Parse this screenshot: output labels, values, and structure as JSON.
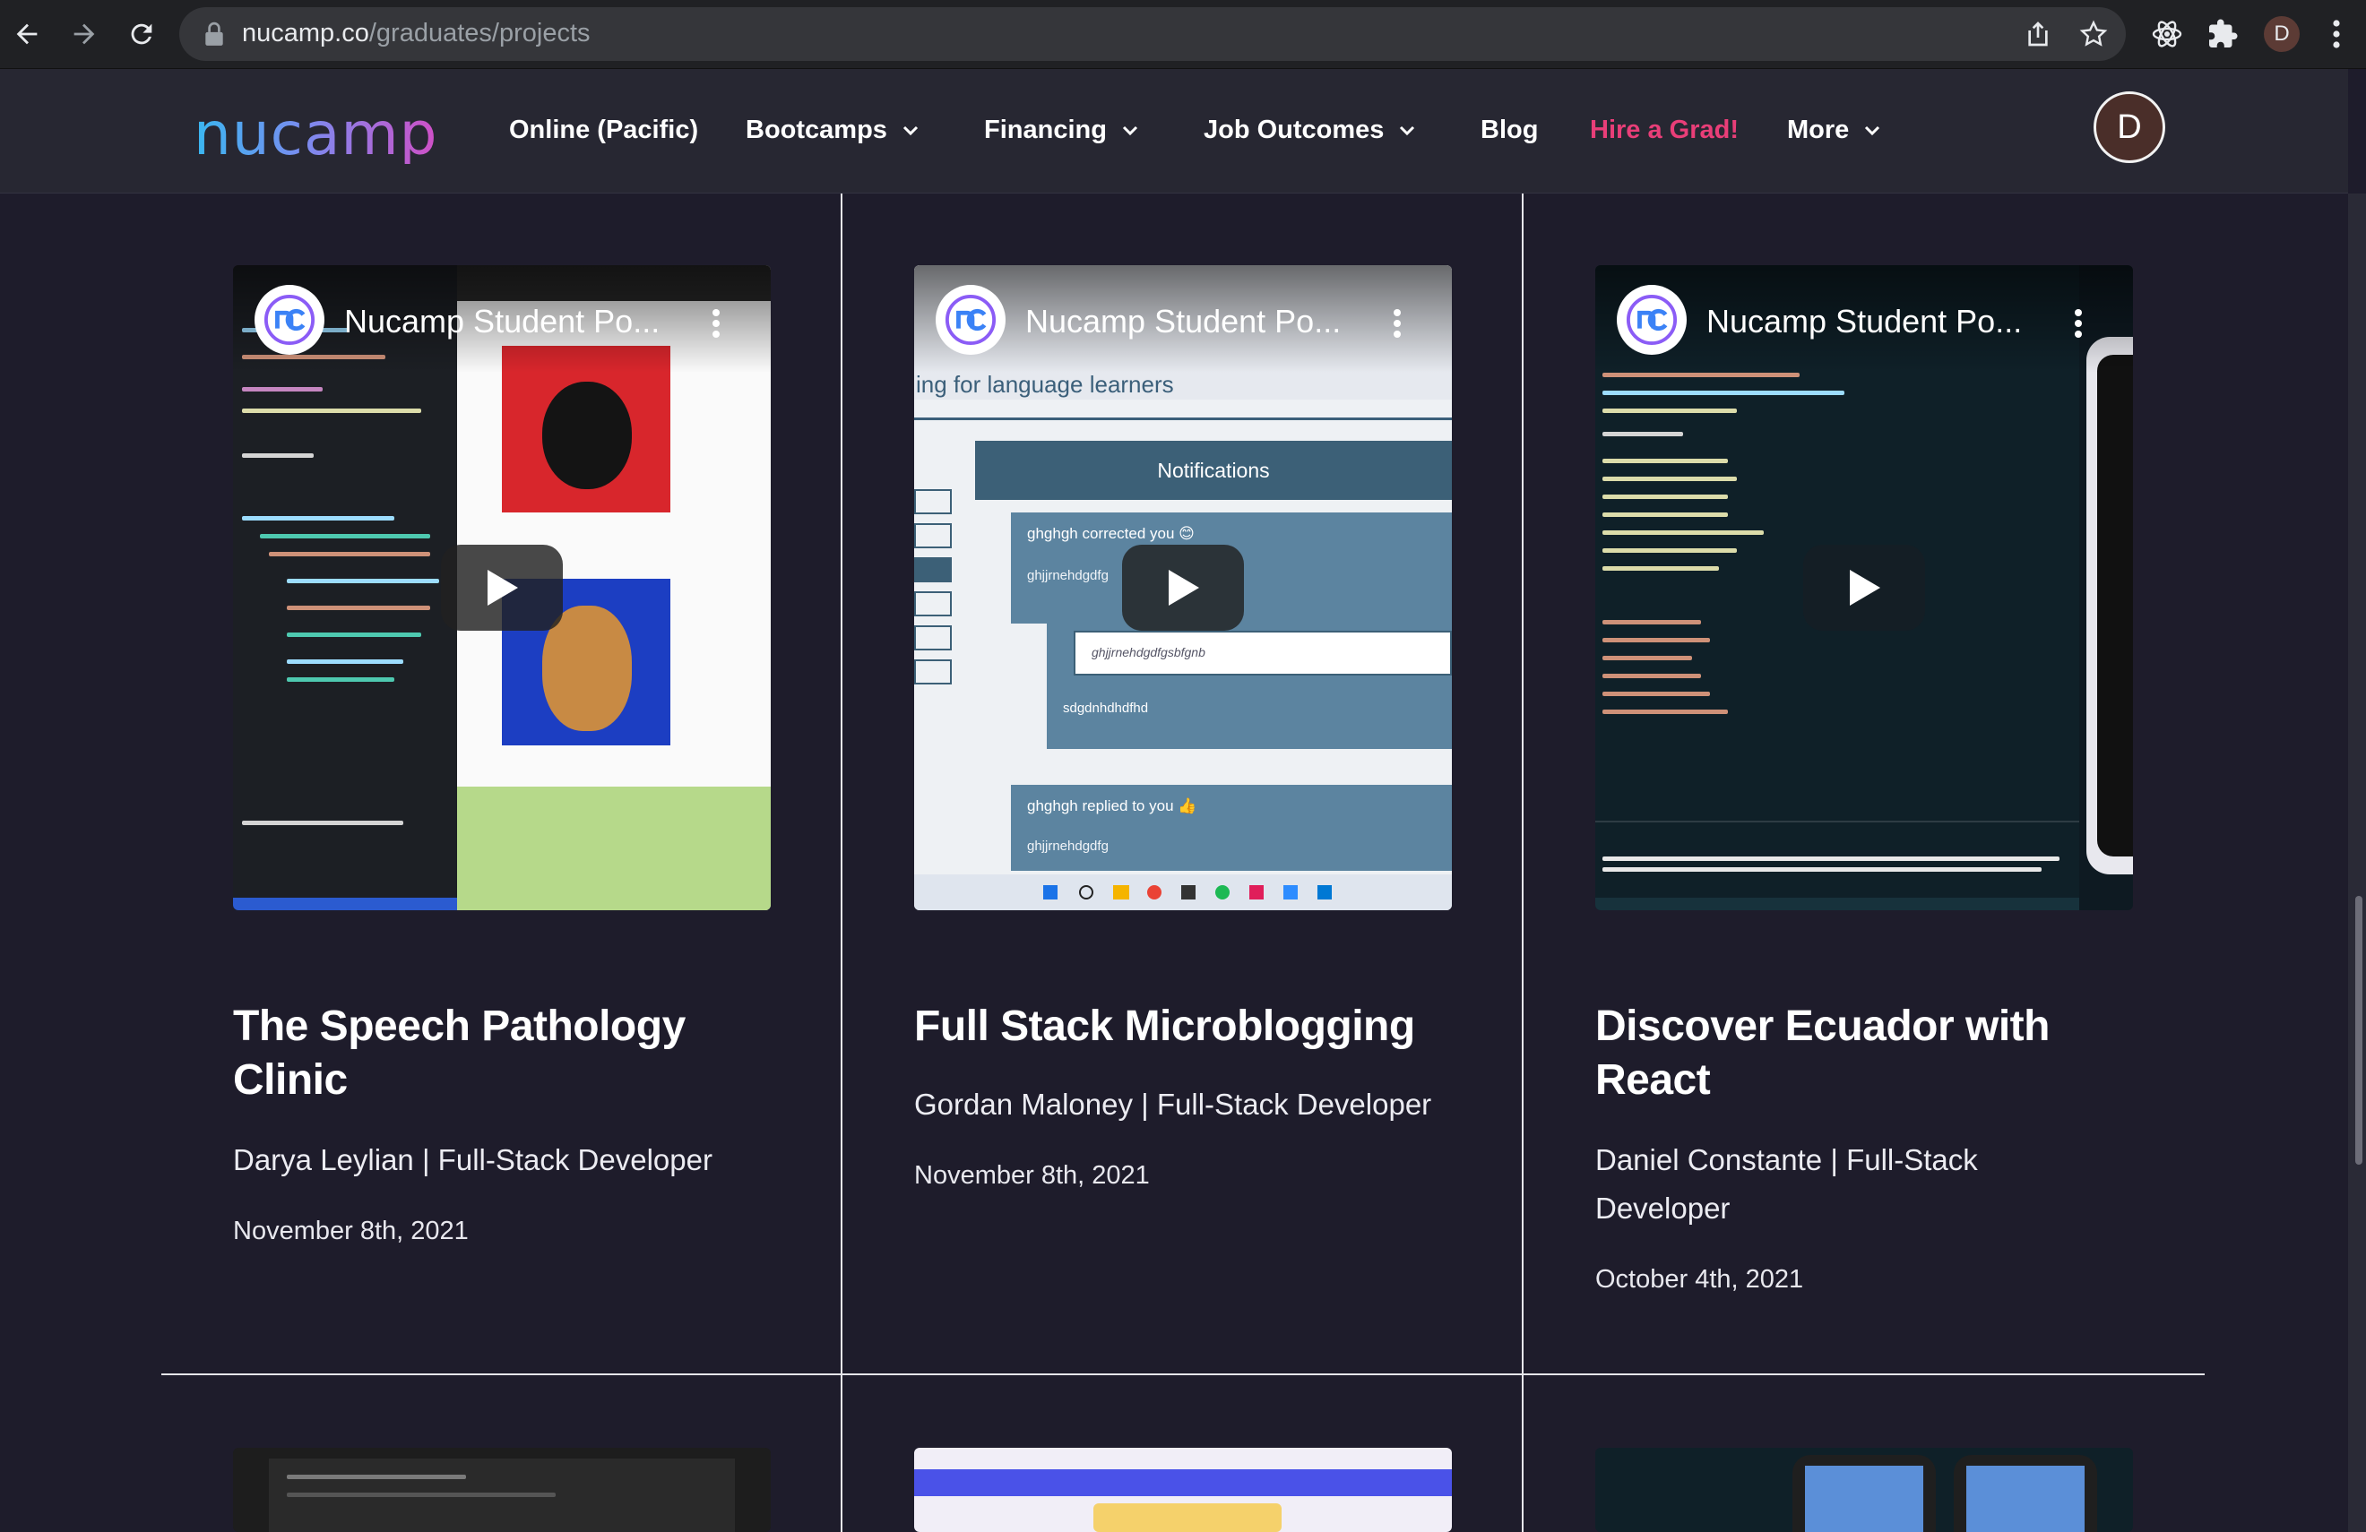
{
  "browser": {
    "url_host": "nucamp.co",
    "url_path": "/graduates/projects",
    "profile_initial": "D"
  },
  "site": {
    "logo_text": "nucamp",
    "menu": [
      {
        "label": "Online (Pacific)",
        "dropdown": false
      },
      {
        "label": "Bootcamps",
        "dropdown": true
      },
      {
        "label": "Financing",
        "dropdown": true
      },
      {
        "label": "Job Outcomes",
        "dropdown": true
      },
      {
        "label": "Blog",
        "dropdown": false
      },
      {
        "label": "Hire a Grad!",
        "dropdown": false,
        "highlight": "#e93e78"
      },
      {
        "label": "More",
        "dropdown": true
      }
    ],
    "avatar_initial": "D"
  },
  "projects": [
    {
      "video_title": "Nucamp Student Po...",
      "title": "The Speech Pathology Clinic",
      "author": "Darya Leylian | Full-Stack Developer",
      "date": "November 8th, 2021"
    },
    {
      "video_title": "Nucamp Student Po...",
      "title": "Full Stack Microblogging",
      "author": "Gordan Maloney | Full-Stack Developer",
      "date": "November 8th, 2021",
      "screenshot": {
        "banner": "ing for language learners",
        "notifications": "Notifications",
        "item1": "ghghgh corrected you 😊",
        "item1_sub": "ghjjrnehdgdfg",
        "reply_placeholder": "ghjjrnehdgdfgsbfgnb",
        "reply_text": "sdgdnhdhdfhd",
        "item2": "ghghgh replied to you 👍",
        "item2_sub": "ghjjrnehdgdfg"
      }
    },
    {
      "video_title": "Nucamp Student Po...",
      "title": "Discover Ecuador with React",
      "author": "Daniel Constante | Full-Stack Developer",
      "date": "October 4th, 2021"
    }
  ],
  "colors": {
    "page_bg": "#1e1c2b",
    "header_bg": "#272732",
    "accent_pink": "#e93e78"
  }
}
